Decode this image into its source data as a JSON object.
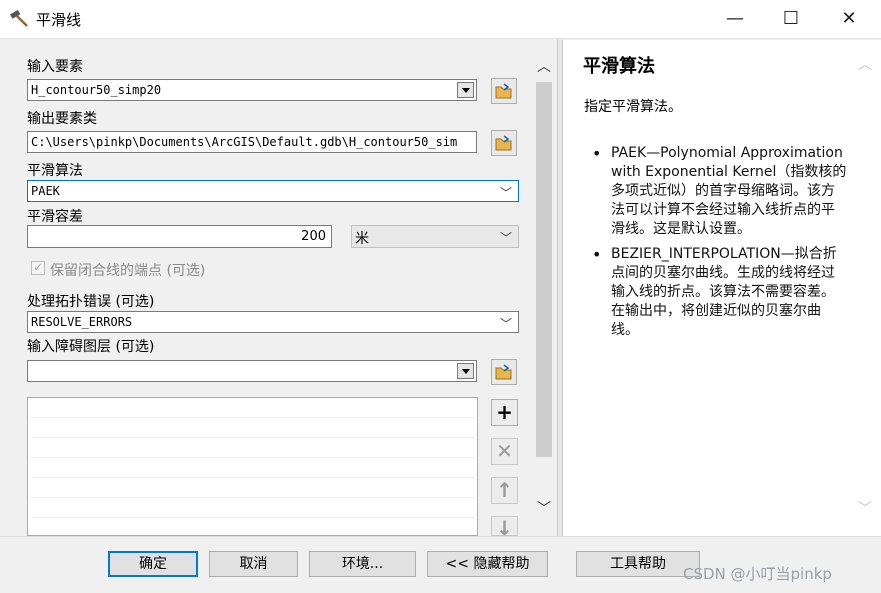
{
  "window": {
    "title": "平滑线",
    "minimize": "—",
    "maximize": "☐",
    "close": "✕"
  },
  "form": {
    "input_features_label": "输入要素",
    "input_features_value": "H_contour50_simp20",
    "output_features_label": "输出要素类",
    "output_features_value": "C:\\Users\\pinkp\\Documents\\ArcGIS\\Default.gdb\\H_contour50_sim",
    "algorithm_label": "平滑算法",
    "algorithm_value": "PAEK",
    "tolerance_label": "平滑容差",
    "tolerance_value": "200",
    "tolerance_unit": "米",
    "preserve_endpoint_label": "保留闭合线的端点 (可选)",
    "preserve_endpoint_checked": true,
    "topology_label": "处理拓扑错误 (可选)",
    "topology_value": "RESOLVE_ERRORS",
    "barrier_label": "输入障碍图层 (可选)",
    "barrier_value": ""
  },
  "list_buttons": {
    "add": "+",
    "remove": "✕",
    "up": "↑",
    "down": "↓"
  },
  "help": {
    "title": "平滑算法",
    "intro": "指定平滑算法。",
    "items": [
      "PAEK—Polynomial Approximation with Exponential Kernel（指数核的多项式近似）的首字母缩略词。该方法可以计算不会经过输入线折点的平滑线。这是默认设置。",
      "BEZIER_INTERPOLATION—拟合折点间的贝塞尔曲线。生成的线将经过输入线的折点。该算法不需要容差。在输出中，将创建近似的贝塞尔曲线。"
    ]
  },
  "buttons": {
    "ok": "确定",
    "cancel": "取消",
    "environments": "环境...",
    "hide_help": "<< 隐藏帮助",
    "tool_help": "工具帮助"
  },
  "watermark": "CSDN @小叮当pinkp"
}
